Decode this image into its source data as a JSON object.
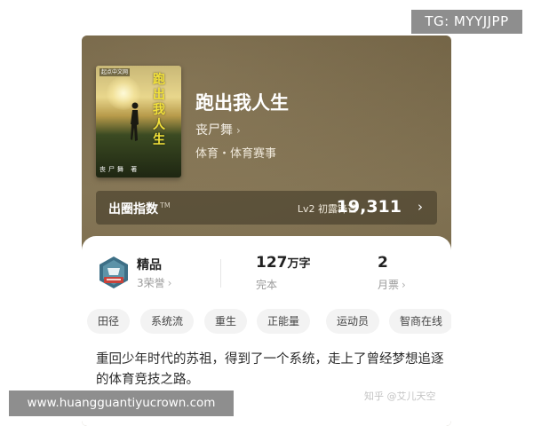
{
  "overlay": {
    "tg_label": "TG: MYYJJPP",
    "url_label": "www.huangguantiyucrown.com"
  },
  "book": {
    "title": "跑出我人生",
    "author": "丧尸舞",
    "author_chevron": "›",
    "genre": "体育・体育赛事",
    "cover": {
      "publisher_mark": "起点中文网",
      "title": "跑出我人生",
      "author": "丧尸舞 著"
    }
  },
  "index_bar": {
    "label": "出圈指数",
    "trademark": "TM",
    "level": "Lv2 初露锋芒",
    "value": "19,311",
    "chevron": "›"
  },
  "stats": {
    "quality": {
      "label": "精品",
      "sub": "3荣誉",
      "chevron": "›"
    },
    "words": {
      "value": "127",
      "unit": "万字",
      "sub": "完本"
    },
    "tickets": {
      "value": "2",
      "sub": "月票",
      "chevron": "›"
    }
  },
  "tags": [
    "田径",
    "系统流",
    "重生",
    "正能量",
    "运动员",
    "智商在线"
  ],
  "description": "重回少年时代的苏祖，得到了一个系统，走上了曾经梦想追逐的体育竞技之路。",
  "watermark": "知乎 @艾儿天空",
  "colors": {
    "card_bg": "#7e6f50",
    "accent_yellow": "#f3e23a",
    "panel_bg": "#ffffff",
    "tag_bg": "#f3f3f3"
  },
  "icons": {
    "badge": "quality-badge-icon",
    "chevron": "chevron-right-icon"
  }
}
